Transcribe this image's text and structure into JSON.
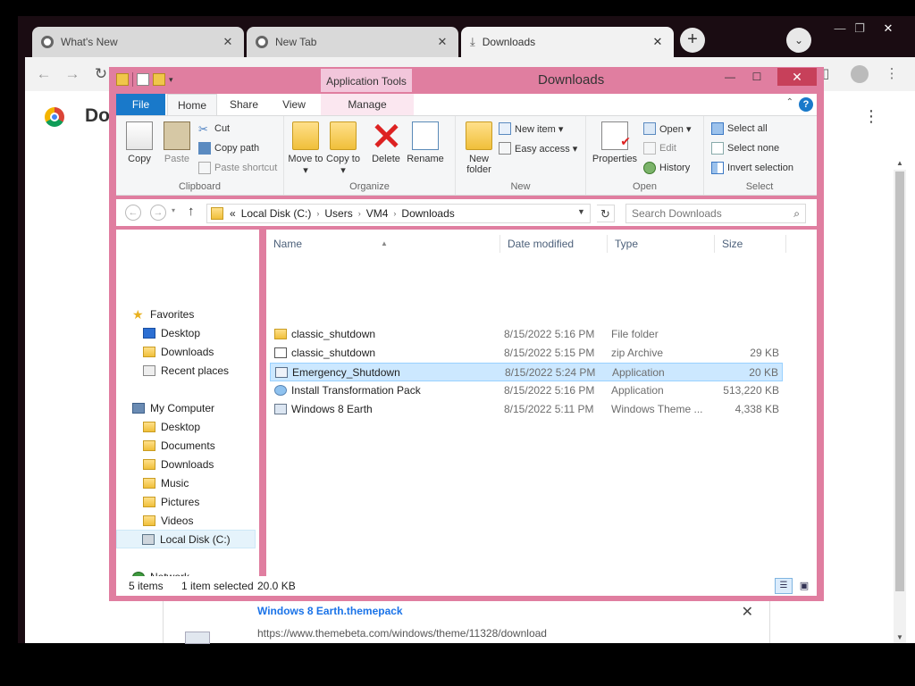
{
  "browser": {
    "tabs": [
      {
        "label": "What's New"
      },
      {
        "label": "New Tab"
      },
      {
        "label": "Downloads"
      }
    ],
    "page_heading": "Do",
    "download_item": {
      "name": "Windows 8 Earth.themepack",
      "url": "https://www.themebeta.com/windows/theme/11328/download"
    }
  },
  "explorer": {
    "title": "Downloads",
    "context_tab": "Application Tools",
    "ribbon_tabs": {
      "file": "File",
      "home": "Home",
      "share": "Share",
      "view": "View",
      "manage": "Manage"
    },
    "ribbon": {
      "clipboard": {
        "label": "Clipboard",
        "copy": "Copy",
        "paste": "Paste",
        "cut": "Cut",
        "copy_path": "Copy path",
        "paste_shortcut": "Paste shortcut"
      },
      "organize": {
        "label": "Organize",
        "move_to": "Move to ▾",
        "copy_to": "Copy to ▾",
        "delete": "Delete",
        "rename": "Rename"
      },
      "new": {
        "label": "New",
        "new_folder": "New folder",
        "new_item": "New item ▾",
        "easy_access": "Easy access ▾"
      },
      "open": {
        "label": "Open",
        "properties": "Properties",
        "open": "Open ▾",
        "edit": "Edit",
        "history": "History"
      },
      "select": {
        "label": "Select",
        "select_all": "Select all",
        "select_none": "Select none",
        "invert_selection": "Invert selection"
      }
    },
    "address": {
      "crumbs": [
        "«",
        "Local Disk (C:)",
        "Users",
        "VM4",
        "Downloads"
      ],
      "search_placeholder": "Search Downloads"
    },
    "nav": {
      "favorites": "Favorites",
      "fav_desktop": "Desktop",
      "fav_downloads": "Downloads",
      "fav_recent": "Recent places",
      "my_computer": "My Computer",
      "pc_desktop": "Desktop",
      "pc_documents": "Documents",
      "pc_downloads": "Downloads",
      "pc_music": "Music",
      "pc_pictures": "Pictures",
      "pc_videos": "Videos",
      "pc_local_disk": "Local Disk (C:)",
      "network": "Network"
    },
    "columns": {
      "name": "Name",
      "date": "Date modified",
      "type": "Type",
      "size": "Size"
    },
    "files": [
      {
        "name": "classic_shutdown",
        "date": "8/15/2022 5:16 PM",
        "type": "File folder",
        "size": ""
      },
      {
        "name": "classic_shutdown",
        "date": "8/15/2022 5:15 PM",
        "type": "zip Archive",
        "size": "29 KB"
      },
      {
        "name": "Emergency_Shutdown",
        "date": "8/15/2022 5:24 PM",
        "type": "Application",
        "size": "20 KB"
      },
      {
        "name": "Install Transformation Pack",
        "date": "8/15/2022 5:16 PM",
        "type": "Application",
        "size": "513,220 KB"
      },
      {
        "name": "Windows 8 Earth",
        "date": "8/15/2022 5:11 PM",
        "type": "Windows Theme ...",
        "size": "4,338 KB"
      }
    ],
    "status": {
      "count": "5 items",
      "selected": "1 item selected",
      "size": "20.0 KB"
    }
  }
}
